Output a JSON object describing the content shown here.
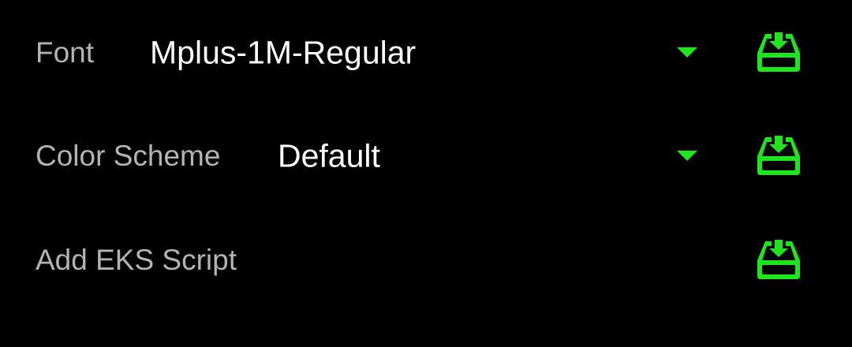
{
  "settings": {
    "font": {
      "label": "Font",
      "value": "Mplus-1M-Regular",
      "action_icon": "import-icon"
    },
    "color_scheme": {
      "label": "Color Scheme",
      "value": "Default",
      "action_icon": "import-icon"
    },
    "eks_script": {
      "label": "Add EKS Script",
      "action_icon": "import-icon"
    }
  },
  "colors": {
    "background": "#000000",
    "label": "#b3b3b3",
    "value": "#ffffff",
    "accent": "#1ee51e"
  }
}
